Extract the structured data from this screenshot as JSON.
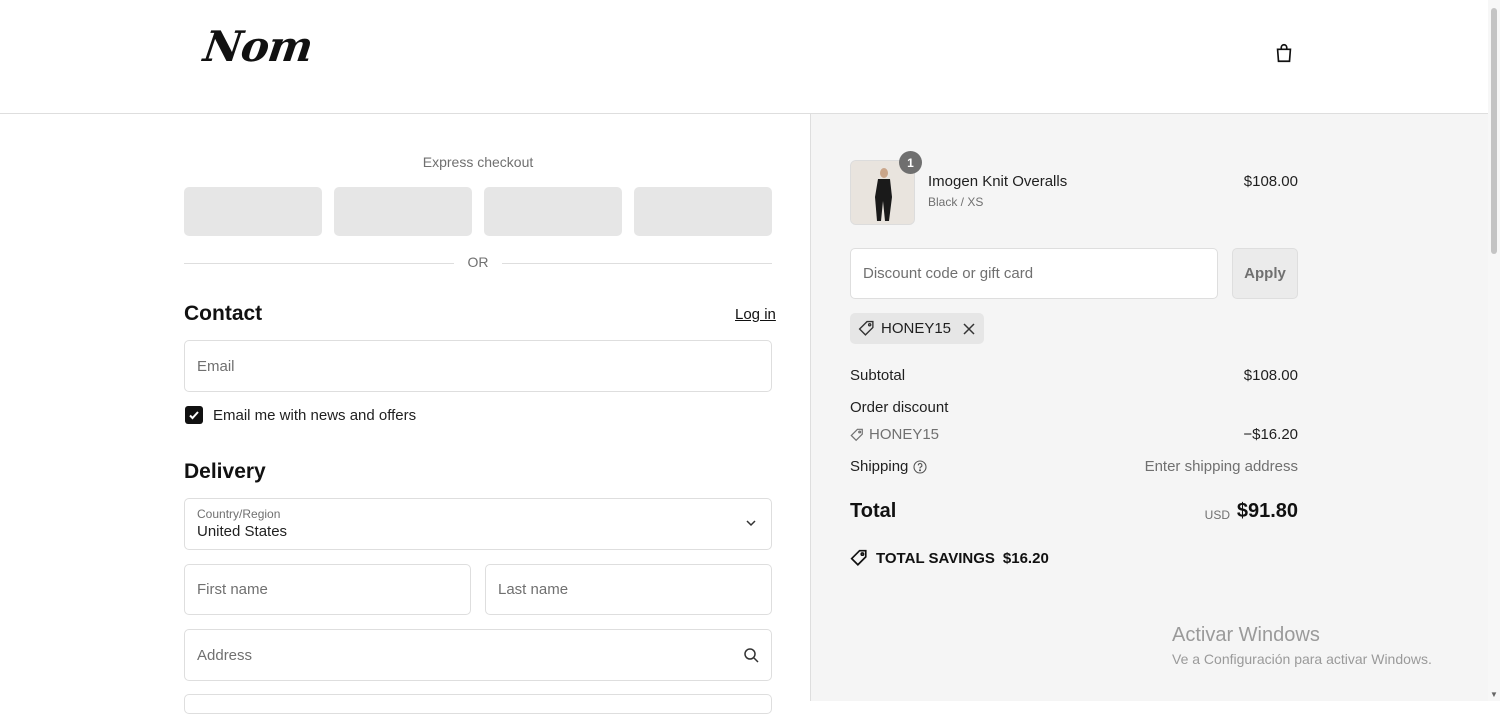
{
  "header": {
    "logo_text": "Nom"
  },
  "checkout": {
    "express_title": "Express checkout",
    "or_text": "OR",
    "contact": {
      "title": "Contact",
      "login_label": "Log in",
      "email_placeholder": "Email",
      "newsletter_label": "Email me with news and offers",
      "newsletter_checked": true
    },
    "delivery": {
      "title": "Delivery",
      "country_label": "Country/Region",
      "country_value": "United States",
      "first_name_placeholder": "First name",
      "last_name_placeholder": "Last name",
      "address_placeholder": "Address"
    }
  },
  "summary": {
    "item": {
      "quantity": "1",
      "name": "Imogen Knit Overalls",
      "variant": "Black / XS",
      "price": "$108.00"
    },
    "discount_placeholder": "Discount code or gift card",
    "apply_label": "Apply",
    "applied_code": "HONEY15",
    "subtotal_label": "Subtotal",
    "subtotal_value": "$108.00",
    "order_discount_label": "Order discount",
    "discount_code": "HONEY15",
    "discount_value": "−$16.20",
    "shipping_label": "Shipping",
    "shipping_value": "Enter shipping address",
    "total_label": "Total",
    "total_currency": "USD",
    "total_value": "$91.80",
    "savings_label": "TOTAL SAVINGS",
    "savings_value": "$16.20"
  },
  "watermark": {
    "title": "Activar Windows",
    "subtitle": "Ve a Configuración para activar Windows."
  },
  "icons": [
    "cart-icon",
    "chevron-down-icon",
    "search-icon",
    "tag-icon",
    "close-icon",
    "help-icon",
    "check-icon"
  ],
  "colors": {
    "accent": "#111111",
    "panel_bg": "#f5f5f5",
    "button_bg": "#e6e6e6",
    "muted_text": "#707070"
  }
}
